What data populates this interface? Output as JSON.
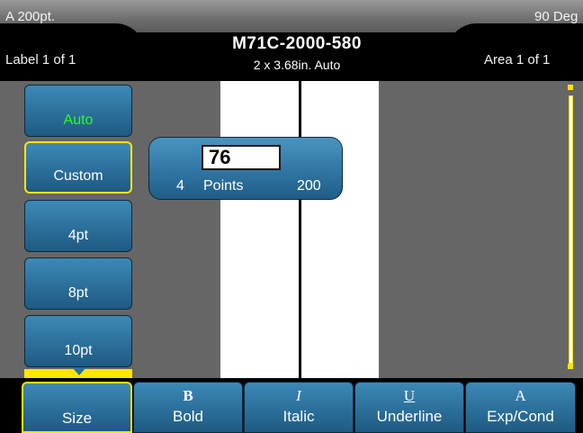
{
  "header": {
    "top_left": "A 200pt.",
    "top_right": "90 Deg",
    "label_info": "Label  1 of 1",
    "area_info": "Area  1 of 1",
    "title": "M71C-2000-580",
    "subtitle": "2 x 3.68in.  Auto"
  },
  "size_list": {
    "items": [
      {
        "label": "Auto"
      },
      {
        "label": "Custom"
      },
      {
        "label": "4pt"
      },
      {
        "label": "8pt"
      },
      {
        "label": "10pt"
      }
    ],
    "selected": "Custom"
  },
  "popup": {
    "value": "76",
    "min": "4",
    "unit": "Points",
    "max": "200"
  },
  "toolbar": {
    "size": {
      "label": "Size"
    },
    "bold": {
      "label": "Bold",
      "icon": "B"
    },
    "italic": {
      "label": "Italic",
      "icon": "I"
    },
    "underline": {
      "label": "Underline",
      "icon": "U"
    },
    "expcond": {
      "label": "Exp/Cond",
      "icon": "A"
    }
  },
  "colors": {
    "accent_yellow": "#ffe600",
    "button_blue": "#2b6f9a",
    "active_green": "#28ff28"
  }
}
